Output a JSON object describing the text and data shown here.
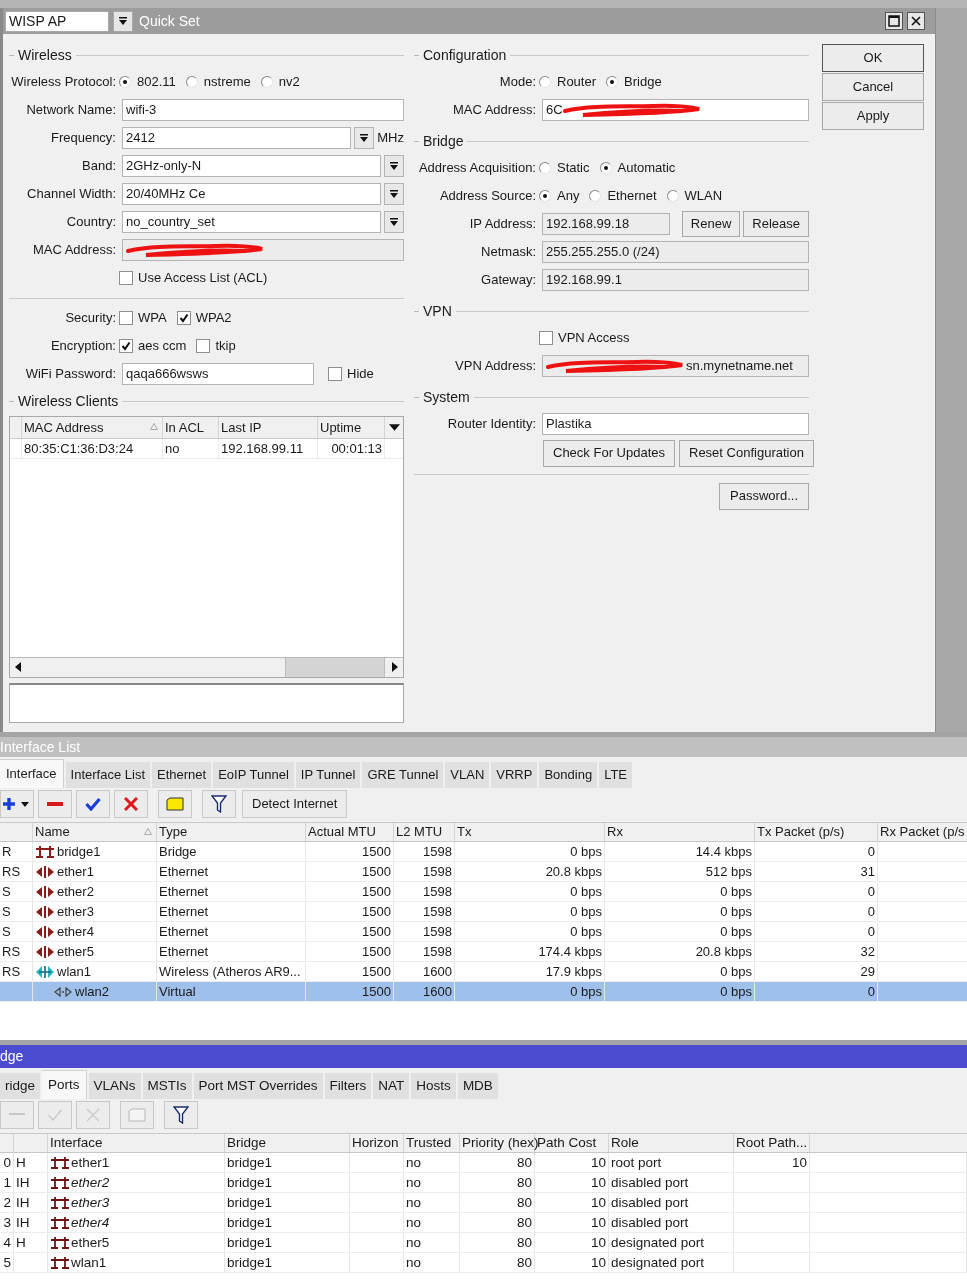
{
  "quick_set": {
    "profile": "WISP AP",
    "title": "Quick Set",
    "left": [
      {
        "title": "Wireless",
        "rows": [
          {
            "kind": "radio",
            "label": "Wireless Protocol:",
            "options": [
              {
                "label": "802.11",
                "selected": true
              },
              {
                "label": "nstreme",
                "selected": false
              },
              {
                "label": "nv2",
                "selected": false
              }
            ]
          },
          {
            "kind": "field",
            "label": "Network Name:",
            "value": "wifi-3"
          },
          {
            "kind": "field",
            "label": "Frequency:",
            "value": "2412",
            "dropdown": true,
            "suffix": "MHz"
          },
          {
            "kind": "field",
            "label": "Band:",
            "value": "2GHz-only-N",
            "dropdown": true
          },
          {
            "kind": "field",
            "label": "Channel Width:",
            "value": "20/40MHz Ce",
            "dropdown": true
          },
          {
            "kind": "field",
            "label": "Country:",
            "value": "no_country_set",
            "dropdown": true
          },
          {
            "kind": "field",
            "label": "MAC Address:",
            "readonly": true,
            "redacted_before": true
          },
          {
            "kind": "check",
            "options": [
              {
                "label": "Use Access List (ACL)",
                "checked": false
              }
            ]
          },
          {
            "kind": "divider"
          },
          {
            "kind": "checks",
            "label": "Security:",
            "options": [
              {
                "label": "WPA",
                "checked": false
              },
              {
                "label": "WPA2",
                "checked": true
              }
            ]
          },
          {
            "kind": "checks",
            "label": "Encryption:",
            "options": [
              {
                "label": "aes ccm",
                "checked": true
              },
              {
                "label": "tkip",
                "checked": false
              }
            ]
          },
          {
            "kind": "field",
            "label": "WiFi Password:",
            "value": "qaqa666wsws",
            "after_check": {
              "label": "Hide",
              "checked": false
            }
          }
        ]
      },
      {
        "title": "Wireless Clients",
        "table": {
          "columns": [
            {
              "label": "MAC Address",
              "sorted": true
            },
            {
              "label": "In ACL",
              "sorted": false
            },
            {
              "label": "Last IP",
              "sorted": false
            },
            {
              "label": "Uptime",
              "sorted": false
            }
          ],
          "rows": [
            [
              "80:35:C1:36:D3:24",
              "no",
              "192.168.99.11",
              "00:01:13"
            ]
          ]
        }
      }
    ],
    "right": [
      {
        "title": "Configuration",
        "rows": [
          {
            "kind": "radio",
            "label": "Mode:",
            "options": [
              {
                "label": "Router",
                "selected": false
              },
              {
                "label": "Bridge",
                "selected": true
              }
            ]
          },
          {
            "kind": "field",
            "label": "MAC Address:",
            "value": "6C",
            "redacted_after": true
          }
        ]
      },
      {
        "title": "Bridge",
        "rows": [
          {
            "kind": "radio",
            "label": "Address Acquisition:",
            "options": [
              {
                "label": "Static",
                "selected": false
              },
              {
                "label": "Automatic",
                "selected": true
              }
            ]
          },
          {
            "kind": "radio",
            "label": "Address Source:",
            "options": [
              {
                "label": "Any",
                "selected": true
              },
              {
                "label": "Ethernet",
                "selected": false
              },
              {
                "label": "WLAN",
                "selected": false
              }
            ]
          },
          {
            "kind": "field",
            "label": "IP Address:",
            "value": "192.168.99.18",
            "readonly": true,
            "buttons": [
              "Renew",
              "Release"
            ]
          },
          {
            "kind": "field",
            "label": "Netmask:",
            "value": "255.255.255.0 (/24)",
            "readonly": true
          },
          {
            "kind": "field",
            "label": "Gateway:",
            "value": "192.168.99.1",
            "readonly": true
          }
        ]
      },
      {
        "title": "VPN",
        "rows": [
          {
            "kind": "check",
            "options": [
              {
                "label": "VPN Access",
                "checked": false
              }
            ]
          },
          {
            "kind": "field",
            "label": "VPN Address:",
            "value": "sn.mynetname.net",
            "readonly": true,
            "redacted_before": true
          }
        ]
      },
      {
        "title": "System",
        "rows": [
          {
            "kind": "field",
            "label": "Router Identity:",
            "value": "Plastika"
          },
          {
            "kind": "buttons",
            "buttons": [
              "Check For Updates",
              "Reset Configuration"
            ]
          },
          {
            "kind": "divider"
          },
          {
            "kind": "right_buttons",
            "buttons": [
              "Password..."
            ]
          }
        ]
      }
    ],
    "buttons": [
      "OK",
      "Cancel",
      "Apply"
    ]
  },
  "interface_list": {
    "title": "Interface List",
    "tabs": [
      {
        "label": "Interface",
        "selected": true
      },
      {
        "label": "Interface List",
        "selected": false
      },
      {
        "label": "Ethernet",
        "selected": false
      },
      {
        "label": "EoIP Tunnel",
        "selected": false
      },
      {
        "label": "IP Tunnel",
        "selected": false
      },
      {
        "label": "GRE Tunnel",
        "selected": false
      },
      {
        "label": "VLAN",
        "selected": false
      },
      {
        "label": "VRRP",
        "selected": false
      },
      {
        "label": "Bonding",
        "selected": false
      },
      {
        "label": "LTE",
        "selected": false
      }
    ],
    "toolbar": [
      {
        "kind": "add"
      },
      {
        "kind": "remove"
      },
      {
        "kind": "enable"
      },
      {
        "kind": "disable"
      },
      {
        "kind": "comment"
      },
      {
        "kind": "filter"
      },
      {
        "kind": "text",
        "label": "Detect Internet"
      }
    ],
    "columns": [
      {
        "label": "Name",
        "sorted": true
      },
      {
        "label": "Type",
        "sorted": false
      },
      {
        "label": "Actual MTU",
        "sorted": false
      },
      {
        "label": "L2 MTU",
        "sorted": false
      },
      {
        "label": "Tx",
        "sorted": false
      },
      {
        "label": "Rx",
        "sorted": false
      },
      {
        "label": "Tx Packet (p/s)",
        "sorted": false
      },
      {
        "label": "Rx Packet (p/s",
        "sorted": false
      }
    ],
    "rows": [
      {
        "flags": "R",
        "kind": "bridge",
        "name": "bridge1",
        "type": "Bridge",
        "actual_mtu": "1500",
        "l2_mtu": "1598",
        "tx": "0 bps",
        "rx": "14.4 kbps",
        "tx_packet": "0",
        "selected": false
      },
      {
        "flags": "RS",
        "kind": "ether",
        "name": "ether1",
        "type": "Ethernet",
        "actual_mtu": "1500",
        "l2_mtu": "1598",
        "tx": "20.8 kbps",
        "rx": "512 bps",
        "tx_packet": "31",
        "selected": false
      },
      {
        "flags": "S",
        "kind": "ether",
        "name": "ether2",
        "type": "Ethernet",
        "actual_mtu": "1500",
        "l2_mtu": "1598",
        "tx": "0 bps",
        "rx": "0 bps",
        "tx_packet": "0",
        "selected": false
      },
      {
        "flags": "S",
        "kind": "ether",
        "name": "ether3",
        "type": "Ethernet",
        "actual_mtu": "1500",
        "l2_mtu": "1598",
        "tx": "0 bps",
        "rx": "0 bps",
        "tx_packet": "0",
        "selected": false
      },
      {
        "flags": "S",
        "kind": "ether",
        "name": "ether4",
        "type": "Ethernet",
        "actual_mtu": "1500",
        "l2_mtu": "1598",
        "tx": "0 bps",
        "rx": "0 bps",
        "tx_packet": "0",
        "selected": false
      },
      {
        "flags": "RS",
        "kind": "ether",
        "name": "ether5",
        "type": "Ethernet",
        "actual_mtu": "1500",
        "l2_mtu": "1598",
        "tx": "174.4 kbps",
        "rx": "20.8 kbps",
        "tx_packet": "32",
        "selected": false
      },
      {
        "flags": "RS",
        "kind": "wireless",
        "name": "wlan1",
        "type": "Wireless (Atheros AR9...",
        "actual_mtu": "1500",
        "l2_mtu": "1600",
        "tx": "17.9 kbps",
        "rx": "0 bps",
        "tx_packet": "29",
        "selected": false,
        "children": [
          {
            "kind": "virtual",
            "name": "wlan2",
            "type": "Virtual",
            "actual_mtu": "1500",
            "l2_mtu": "1600",
            "tx": "0 bps",
            "rx": "0 bps",
            "tx_packet": "0",
            "selected": true
          }
        ]
      }
    ]
  },
  "bridge": {
    "title": "dge",
    "tabs": [
      {
        "label": "ridge",
        "selected": false
      },
      {
        "label": "Ports",
        "selected": true
      },
      {
        "label": "VLANs",
        "selected": false
      },
      {
        "label": "MSTIs",
        "selected": false
      },
      {
        "label": "Port MST Overrides",
        "selected": false
      },
      {
        "label": "Filters",
        "selected": false
      },
      {
        "label": "NAT",
        "selected": false
      },
      {
        "label": "Hosts",
        "selected": false
      },
      {
        "label": "MDB",
        "selected": false
      }
    ],
    "toolbar": [
      {
        "kind": "remove",
        "disabled": true
      },
      {
        "kind": "enable",
        "disabled": true
      },
      {
        "kind": "disable",
        "disabled": true
      },
      {
        "kind": "comment",
        "disabled": true
      },
      {
        "kind": "filter",
        "disabled": false
      }
    ],
    "columns": [
      "Interface",
      "Bridge",
      "Horizon",
      "Trusted",
      "Priority (hex)",
      "Path Cost",
      "Role",
      "Root Path..."
    ],
    "rows": [
      {
        "number": "0",
        "flags": "H",
        "interface": "ether1",
        "inactive": false,
        "bridge": "bridge1",
        "trusted": "no",
        "priority": "80",
        "path_cost": "10",
        "role": "root port",
        "root_path_cost": "10"
      },
      {
        "number": "1",
        "flags": "IH",
        "interface": "ether2",
        "inactive": true,
        "bridge": "bridge1",
        "trusted": "no",
        "priority": "80",
        "path_cost": "10",
        "role": "disabled port"
      },
      {
        "number": "2",
        "flags": "IH",
        "interface": "ether3",
        "inactive": true,
        "bridge": "bridge1",
        "trusted": "no",
        "priority": "80",
        "path_cost": "10",
        "role": "disabled port"
      },
      {
        "number": "3",
        "flags": "IH",
        "interface": "ether4",
        "inactive": true,
        "bridge": "bridge1",
        "trusted": "no",
        "priority": "80",
        "path_cost": "10",
        "role": "disabled port"
      },
      {
        "number": "4",
        "flags": "H",
        "interface": "ether5",
        "inactive": false,
        "bridge": "bridge1",
        "trusted": "no",
        "priority": "80",
        "path_cost": "10",
        "role": "designated port"
      },
      {
        "number": "5",
        "interface": "wlan1",
        "inactive": false,
        "bridge": "bridge1",
        "trusted": "no",
        "priority": "80",
        "path_cost": "10",
        "role": "designated port"
      }
    ]
  }
}
